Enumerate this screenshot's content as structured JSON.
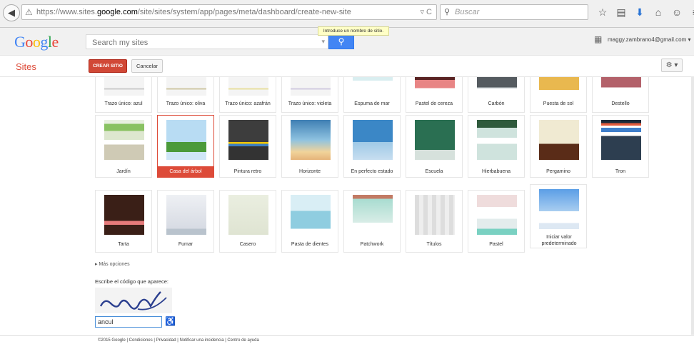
{
  "browser": {
    "url_prefix": "https://www.sites.",
    "url_domain": "google.com",
    "url_path": "/site/sites/system/app/pages/meta/dashboard/create-new-site",
    "search_placeholder": "Buscar",
    "tools_text": "▿ C",
    "search_glyph": "⚲"
  },
  "google": {
    "logo": "Google",
    "search_placeholder": "Search my sites",
    "tooltip": "Introduce un nombre de sitio.",
    "account": "maggy.zambrano4@gmail.com ▾",
    "search_button_glyph": "⚲"
  },
  "sites": {
    "title": "Sites",
    "create_label": "CREAR SITIO",
    "cancel_label": "Cancelar",
    "settings_glyph": "⚙ ▾"
  },
  "themes_row1": [
    "Trazo único: azul",
    "Trazo único: oliva",
    "Trazo único: azafrán",
    "Trazo único: violeta",
    "Espuma de mar",
    "Pastel de cereza",
    "Carbón",
    "Puesta de sol",
    "Destello"
  ],
  "themes_row2": [
    "Jardín",
    "Casa del árbol",
    "Pintura retro",
    "Horizonte",
    "En perfecto estado",
    "Escuela",
    "Hierbabuena",
    "Pergamino",
    "Tron"
  ],
  "themes_row3": [
    "Tarta",
    "Fumar",
    "Casero",
    "Pasta de dientes",
    "Patchwork",
    "Títulos",
    "Pastel",
    "Iniciar valor predeterminado"
  ],
  "selected_theme": "Casa del árbol",
  "more_options": "▸ Más opciones",
  "captcha": {
    "prompt": "Escribe el código que aparece:",
    "value": "ancul",
    "image_text": "ancul",
    "audio_glyph": "♿"
  },
  "footer": "©2015 Google | Condiciones | Privacidad | Notificar una incidencia | Centro de ayuda",
  "colors": {
    "accent": "#dd4b39",
    "google_blue": "#4285f4"
  }
}
